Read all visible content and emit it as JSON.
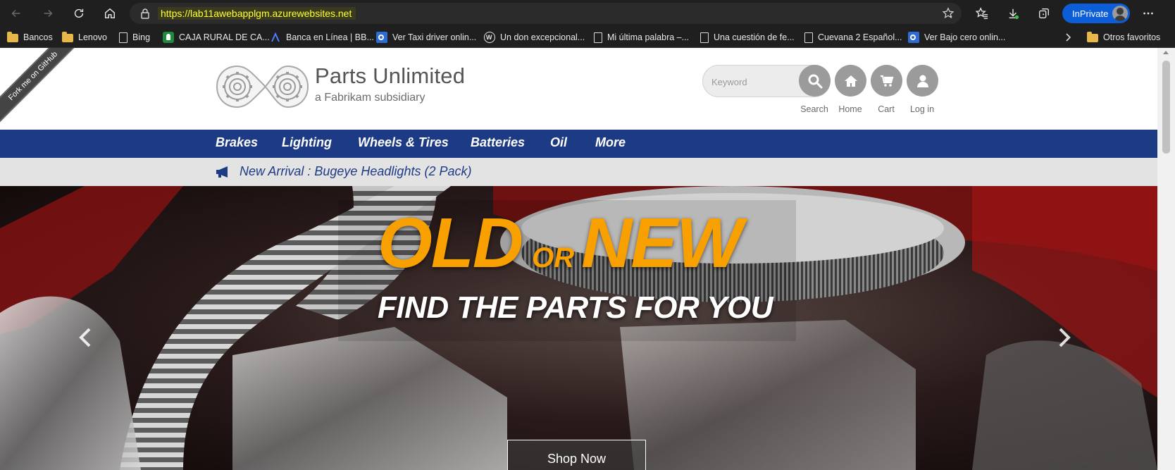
{
  "browser": {
    "url": "https://lab11awebapplgm.azurewebsites.net",
    "inprivate_label": "InPrivate",
    "bookmarks": [
      {
        "label": "Bancos",
        "icon": "folder-icon"
      },
      {
        "label": "Lenovo",
        "icon": "folder-icon"
      },
      {
        "label": "Bing",
        "icon": "page-icon"
      },
      {
        "label": "CAJA RURAL DE CA...",
        "icon": "caja-rural-icon"
      },
      {
        "label": "Banca en Línea | BB...",
        "icon": "bbva-icon"
      },
      {
        "label": "Ver Taxi driver onlin...",
        "icon": "outlook-icon"
      },
      {
        "label": "Un don excepcional...",
        "icon": "wordpress-icon"
      },
      {
        "label": "Mi última palabra –...",
        "icon": "page-icon"
      },
      {
        "label": "Una cuestión de fe...",
        "icon": "page-icon"
      },
      {
        "label": "Cuevana 2 Español...",
        "icon": "page-icon"
      },
      {
        "label": "Ver Bajo cero onlin...",
        "icon": "outlook-icon"
      }
    ],
    "other_favorites": "Otros favoritos"
  },
  "site": {
    "ribbon": "Fork me on GitHub",
    "brand": "Parts Unlimited",
    "tagline": "a Fabrikam subsidiary",
    "search_placeholder": "Keyword",
    "actions": {
      "search": "Search",
      "home": "Home",
      "cart": "Cart",
      "login": "Log in"
    },
    "categories": [
      "Brakes",
      "Lighting",
      "Wheels & Tires",
      "Batteries",
      "Oil",
      "More"
    ],
    "announcement": "New Arrival : Bugeye Headlights (2 Pack)",
    "hero": {
      "word1": "OLD",
      "word_or": "OR",
      "word2": "NEW",
      "subline": "FIND THE PARTS FOR YOU",
      "cta": "Shop Now"
    }
  },
  "colors": {
    "nav": "#1d3a85",
    "accent": "#f7a000",
    "button_gray": "#9b9b9b"
  }
}
